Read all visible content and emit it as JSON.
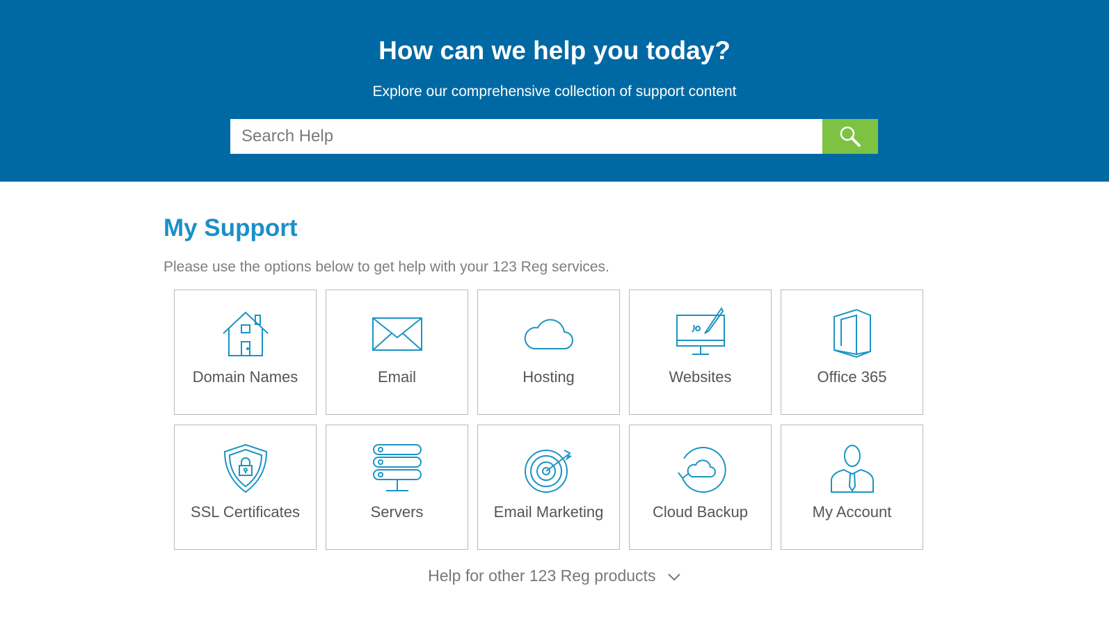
{
  "hero": {
    "title": "How can we help you today?",
    "subtitle": "Explore our comprehensive collection of support content",
    "search_placeholder": "Search Help",
    "search_icon": "search-icon"
  },
  "support": {
    "title": "My Support",
    "description": "Please use the options below to get help with your 123 Reg services."
  },
  "tiles": [
    {
      "label": "Domain Names",
      "icon": "house-icon"
    },
    {
      "label": "Email",
      "icon": "envelope-icon"
    },
    {
      "label": "Hosting",
      "icon": "cloud-icon"
    },
    {
      "label": "Websites",
      "icon": "monitor-brush-icon"
    },
    {
      "label": "Office 365",
      "icon": "office-icon"
    },
    {
      "label": "SSL Certificates",
      "icon": "shield-lock-icon"
    },
    {
      "label": "Servers",
      "icon": "server-stack-icon"
    },
    {
      "label": "Email Marketing",
      "icon": "target-icon"
    },
    {
      "label": "Cloud Backup",
      "icon": "cloud-sync-icon"
    },
    {
      "label": "My Account",
      "icon": "user-icon"
    }
  ],
  "footer": {
    "other_products": "Help for other 123 Reg products",
    "icon": "chevron-down-icon"
  },
  "colors": {
    "hero_bg": "#0069a3",
    "search_button": "#7dc242",
    "accent": "#1b8fc8",
    "icon_stroke": "#1a94c4"
  }
}
